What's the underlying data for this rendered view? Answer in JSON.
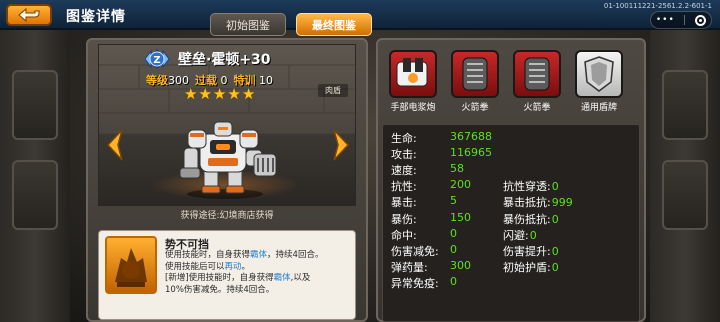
{
  "header": {
    "title": "图鉴详情",
    "version": "01-100111221-2561.2.2-601-1"
  },
  "tabs": [
    {
      "label": "初始图鉴",
      "active": false
    },
    {
      "label": "最终图鉴",
      "active": true
    }
  ],
  "hero": {
    "rank_badge": "Z",
    "name": "壁垒·霍顿+30",
    "level_label": "等级",
    "level_value": "300",
    "overload_label": "过载",
    "overload_value": "0",
    "training_label": "特训",
    "training_value": "10",
    "stars": 5,
    "faction": "肉盾",
    "source": "获得途径:幻境商店获得"
  },
  "skill": {
    "name": "势不可挡",
    "desc_line1_a": "使用技能时，自身获得",
    "desc_line1_hl": "霸体",
    "desc_line1_b": "，持续4回合。",
    "desc_line2_a": "使用技能后可以",
    "desc_line2_hl": "再动",
    "desc_line2_b": "。",
    "desc_line3_a": "[新增]使用技能时，自身获得",
    "desc_line3_hl": "霸体",
    "desc_line3_b": ",以及",
    "desc_line4": "10%伤害减免。持续4回合。"
  },
  "equipment": [
    {
      "label": "手部电浆炮",
      "color": "red",
      "icon": "plasma-cannon-icon"
    },
    {
      "label": "火箭拳",
      "color": "red",
      "icon": "rocket-fist-icon"
    },
    {
      "label": "火箭拳",
      "color": "red",
      "icon": "rocket-fist-icon"
    },
    {
      "label": "通用盾牌",
      "color": "grey",
      "icon": "shield-icon"
    }
  ],
  "stats_left": [
    {
      "label": "生命:",
      "value": "367688"
    },
    {
      "label": "攻击:",
      "value": "116965"
    },
    {
      "label": "速度:",
      "value": "58"
    },
    {
      "label": "抗性:",
      "value": "200"
    },
    {
      "label": "暴击:",
      "value": "5"
    },
    {
      "label": "暴伤:",
      "value": "150"
    },
    {
      "label": "命中:",
      "value": "0"
    },
    {
      "label": "伤害减免:",
      "value": "0"
    },
    {
      "label": "弹药量:",
      "value": "300"
    },
    {
      "label": "异常免疫:",
      "value": "0"
    }
  ],
  "stats_right": [
    {
      "label": "抗性穿透:",
      "value": "0"
    },
    {
      "label": "暴击抵抗:",
      "value": "999"
    },
    {
      "label": "暴伤抵抗:",
      "value": "0"
    },
    {
      "label": "闪避:",
      "value": "0"
    },
    {
      "label": "伤害提升:",
      "value": "0"
    },
    {
      "label": "初始护盾:",
      "value": "0"
    }
  ],
  "colors": {
    "accent_orange": "#ff9a1a",
    "stat_value_green": "#5ce01c",
    "star_gold": "#ffc31a",
    "skill_highlight_blue": "#1e7fd6"
  }
}
